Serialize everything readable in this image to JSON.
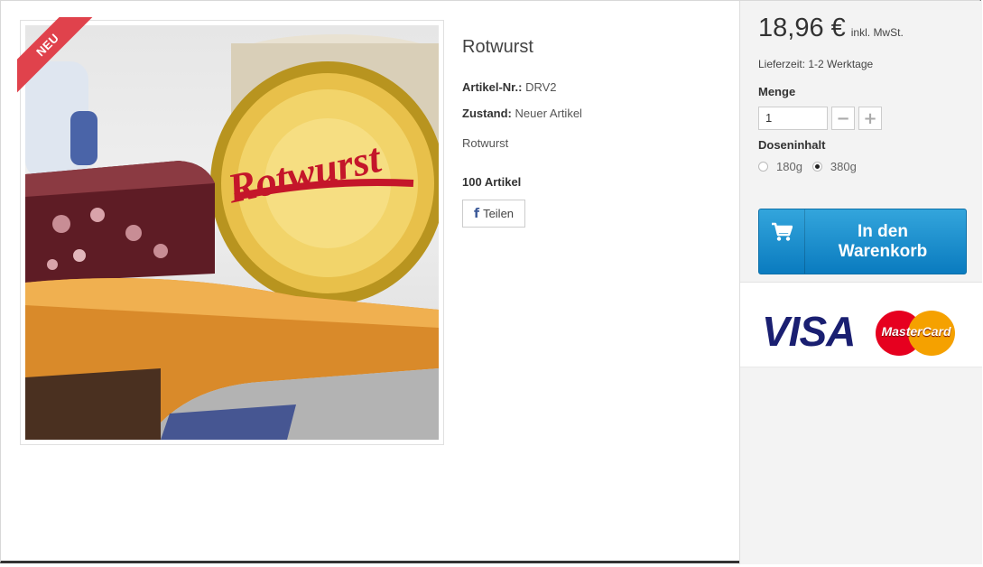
{
  "product": {
    "badge": "NEU",
    "title": "Rotwurst",
    "sku_label": "Artikel-Nr.:",
    "sku_value": "DRV2",
    "condition_label": "Zustand:",
    "condition_value": "Neuer Artikel",
    "short_description": "Rotwurst",
    "stock": "100 Artikel",
    "share_label": "Teilen",
    "image_can_text": "Rotwurst"
  },
  "purchase": {
    "price": "18,96 €",
    "vat_note": "inkl. MwSt.",
    "delivery": "Lieferzeit: 1-2 Werktage",
    "quantity_label": "Menge",
    "quantity_value": "1",
    "minus": "−",
    "plus": "+",
    "variant_label": "Doseninhalt",
    "variants": [
      {
        "label": "180g",
        "selected": false
      },
      {
        "label": "380g",
        "selected": true
      }
    ],
    "cart_line1": "In den",
    "cart_line2": "Warenkorb"
  },
  "payment": {
    "visa": "VISA",
    "mastercard": "MasterCard"
  },
  "colors": {
    "badge": "#e0424c",
    "cart_button": "#1a8fcf",
    "panel_bg": "#f3f3f3"
  },
  "icons": {
    "cart": "shopping-cart-icon",
    "share": "facebook-icon"
  }
}
